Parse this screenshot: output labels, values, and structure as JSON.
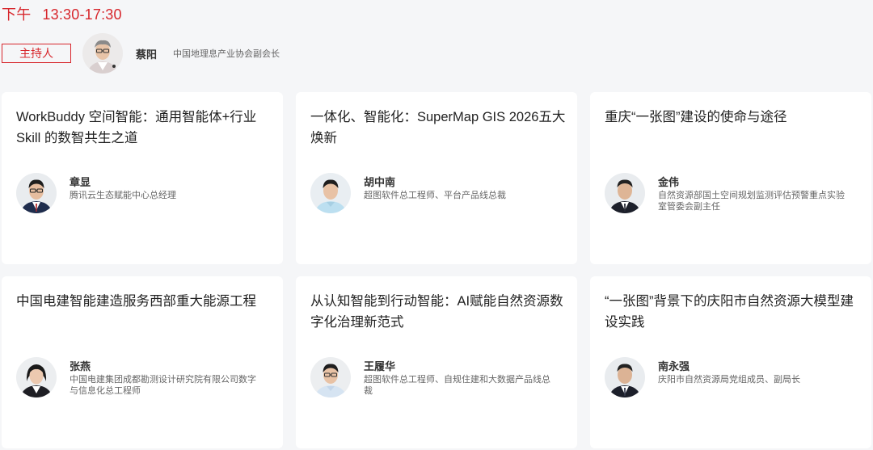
{
  "session": {
    "period": "下午",
    "time": "13:30-17:30"
  },
  "host": {
    "badge": "主持人",
    "name": "蔡阳",
    "title": "中国地理息产业协会副会长"
  },
  "talks": [
    {
      "title": "WorkBuddy 空间智能：通用智能体+行业Skill 的数智共生之道",
      "speaker": "章显",
      "role": "腾讯云生态赋能中心总经理"
    },
    {
      "title": "一体化、智能化：SuperMap GIS 2026五大焕新",
      "speaker": "胡中南",
      "role": "超图软件总工程师、平台产品线总裁"
    },
    {
      "title": "重庆“一张图”建设的使命与途径",
      "speaker": "金伟",
      "role": "自然资源部国土空间规划监测评估预警重点实验室管委会副主任"
    },
    {
      "title": "中国电建智能建造服务西部重大能源工程",
      "speaker": "张燕",
      "role": "中国电建集团成都勘测设计研究院有限公司数字与信息化总工程师"
    },
    {
      "title": "从认知智能到行动智能：AI赋能自然资源数字化治理新范式",
      "speaker": "王履华",
      "role": "超图软件总工程师、自规住建和大数据产品线总裁"
    },
    {
      "title": "“一张图”背景下的庆阳市自然资源大模型建设实践",
      "speaker": "南永强",
      "role": "庆阳市自然资源局党组成员、副局长"
    }
  ]
}
